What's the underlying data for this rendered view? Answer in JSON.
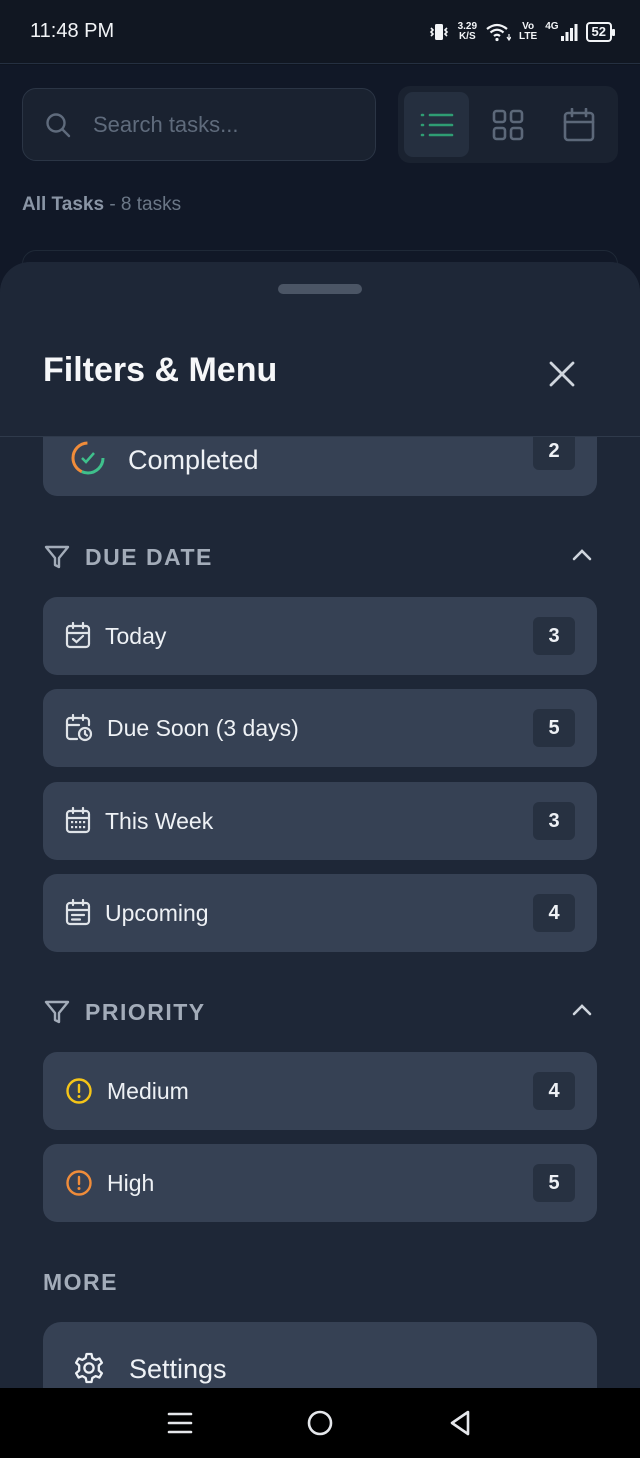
{
  "status_bar": {
    "time": "11:48 PM",
    "net_speed_value": "3.29",
    "net_speed_unit": "K/S",
    "volte_top": "Vo",
    "volte_bottom": "LTE",
    "network": "4G",
    "battery": "52"
  },
  "background": {
    "search_placeholder": "Search tasks...",
    "list_title": "All Tasks",
    "list_count": "- 8 tasks"
  },
  "sheet": {
    "title": "Filters & Menu",
    "status_partial": {
      "label": "Completed",
      "count": "2"
    },
    "due_date": {
      "title": "DUE DATE",
      "items": [
        {
          "label": "Today",
          "count": "3",
          "icon": "calendar-check-icon"
        },
        {
          "label": "Due Soon (3 days)",
          "count": "5",
          "icon": "calendar-clock-icon"
        },
        {
          "label": "This Week",
          "count": "3",
          "icon": "calendar-week-icon"
        },
        {
          "label": "Upcoming",
          "count": "4",
          "icon": "calendar-range-icon"
        }
      ]
    },
    "priority": {
      "title": "PRIORITY",
      "items": [
        {
          "label": "Medium",
          "count": "4",
          "color": "#f5c518"
        },
        {
          "label": "High",
          "count": "5",
          "color": "#f08c3a"
        }
      ]
    },
    "more": {
      "title": "MORE",
      "settings_label": "Settings"
    }
  },
  "colors": {
    "accent": "#3fc08c",
    "sheet_bg": "#1e2737",
    "item_bg": "#364154"
  }
}
